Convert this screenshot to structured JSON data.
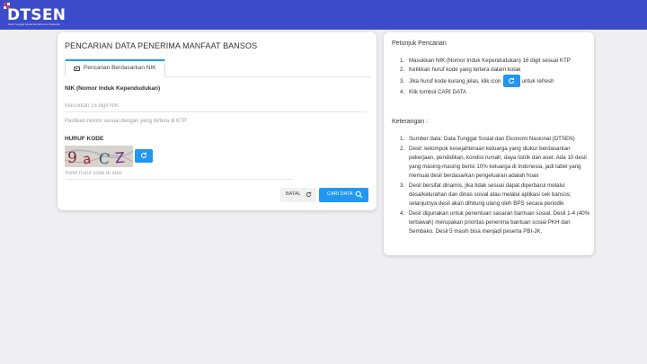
{
  "brand": {
    "logo_text": "DTSEN",
    "logo_subtitle": "Data Tunggal Sosial dan Ekonomi Nasional",
    "accent": "#3b4bc9"
  },
  "search_form": {
    "title": "PENCARIAN DATA PENERIMA MANFAAT BANSOS",
    "tab_label": "Pencarian Berdasarkan NIK",
    "tab_icon": "id-card-icon",
    "nik_label": "NIK (Nomor Induk Kependudukan)",
    "nik_placeholder": "Masukkan 16 digit NIK",
    "nik_helper": "Pastikan nomor sesuai dengan yang tertera di KTP",
    "kode_label": "HURUF KODE",
    "captcha_text": "9aCZ",
    "kode_placeholder": "Ketik huruf kode di atas",
    "cancel_label": "BATAL",
    "search_label": "CARI DATA",
    "primary_color": "#2196f3"
  },
  "instructions": {
    "title": "Petunjuk Pencarian",
    "steps": [
      "Masukkan NIK (Nomor Induk Kependudukan) 16 digit sesuai KTP",
      "Ketikkan huruf kode yang tertera dalam kotak",
      "Jika huruf kode kurang jelas, klik icon",
      "Klik tombol CARI DATA"
    ],
    "step3_suffix": "untuk refresh",
    "notes_title": "Keterangan :",
    "notes": [
      "Sumber data: Data Tunggal Sosial dan Ekonomi Nasional (DTSEN)",
      "Desil: kelompok kesejahteraan keluarga yang diukur berdasarkan pekerjaan, pendidikan, kondisi rumah, daya listrik dan aset. Ada 10 desil yang masing-masing berisi 10% keluarga di Indonesia, jadi tabel yang memuat desil berdasarkan pengeluaran adalah hoax",
      "Desil bersifat dinamis, jika tidak sesuai dapat diperbarui melalui desa/kelurahan dan dinas sosial atau melalui aplikasi cek bansos; selanjutnya desil akan dihitung ulang oleh BPS secara periodik",
      "Desil digunakan untuk penentuan sasaran bantuan sosial. Desil 1-4 (40% terbawah) merupakan prioritas penerima bantuan sosial PKH dan Sembako. Desil 5 masih bisa menjadi peserta PBI-JK."
    ]
  }
}
